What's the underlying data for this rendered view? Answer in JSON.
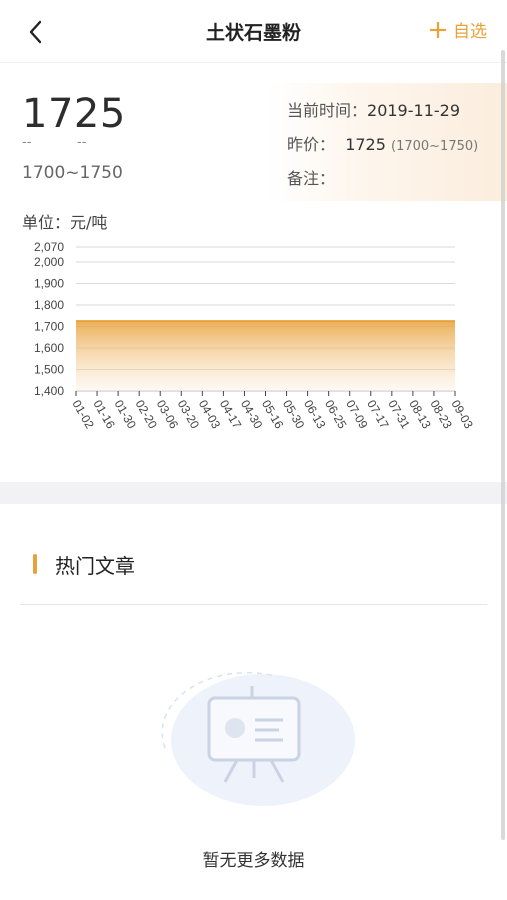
{
  "header": {
    "title": "土状石墨粉",
    "add_label": "自选"
  },
  "price": {
    "current": "1725",
    "change": "--",
    "change_pct": "--",
    "range": "1700~1750"
  },
  "info": {
    "time_label": "当前时间：",
    "time_value": "2019-11-29",
    "prev_label": "昨价：",
    "prev_value": "1725",
    "prev_range": "(1700~1750)",
    "note_label": "备注：",
    "note_value": ""
  },
  "unit_label": "单位：元/吨",
  "chart_data": {
    "type": "area",
    "x": [
      "01-02",
      "01-16",
      "01-30",
      "02-20",
      "03-06",
      "03-20",
      "04-03",
      "04-17",
      "04-30",
      "05-16",
      "05-30",
      "06-13",
      "06-25",
      "07-09",
      "07-17",
      "07-31",
      "08-13",
      "08-23",
      "09-03"
    ],
    "values": [
      1725,
      1725,
      1725,
      1725,
      1725,
      1725,
      1725,
      1725,
      1725,
      1725,
      1725,
      1725,
      1725,
      1725,
      1725,
      1725,
      1725,
      1725,
      1725
    ],
    "yticks": [
      1400,
      1500,
      1600,
      1700,
      1800,
      1900,
      2000,
      2070
    ],
    "ylim": [
      1400,
      2070
    ],
    "xlabel": "",
    "ylabel": "",
    "grid": true,
    "color": "#e8a23a"
  },
  "hot": {
    "title": "热门文章",
    "empty_text": "暂无更多数据"
  },
  "colors": {
    "accent": "#e8a23a"
  }
}
